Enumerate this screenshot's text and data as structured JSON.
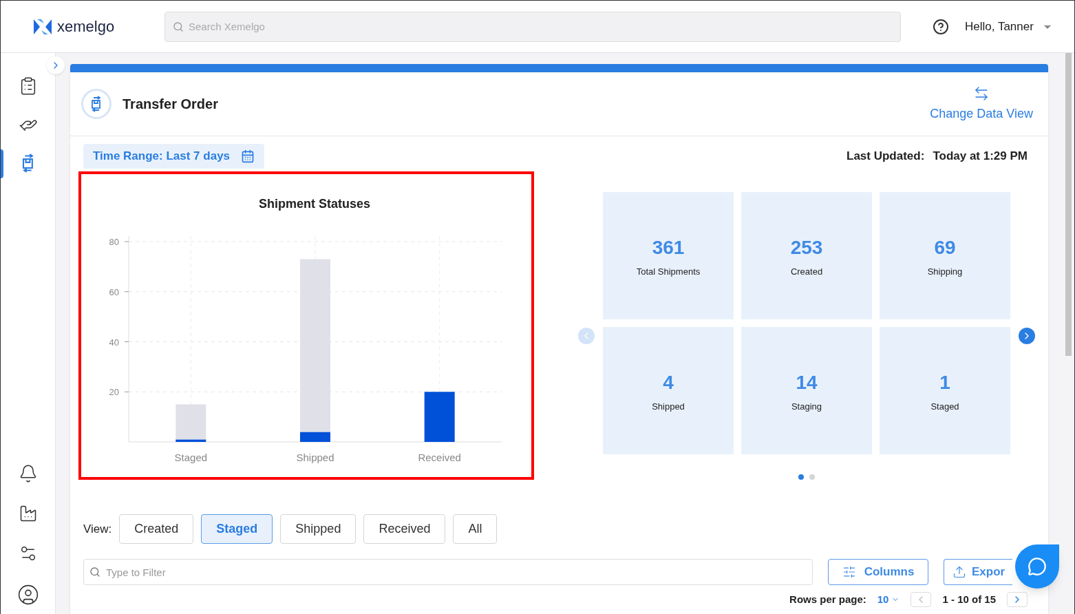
{
  "header": {
    "logo": "xemelgo",
    "search": {
      "placeholder": "Search Xemelgo"
    },
    "user": "Hello, Tanner"
  },
  "sidebar": {
    "items": [
      {
        "selected": false
      },
      {
        "selected": false
      },
      {
        "selected": true
      }
    ]
  },
  "page": {
    "title": "Transfer Order",
    "change_view": "Change Data View",
    "time_range": "Time Range: Last 7 days",
    "last_updated_label": "Last Updated:",
    "last_updated": "Today at 1:29 PM"
  },
  "chart": {
    "chart_data": {
      "type": "bar",
      "title": "Shipment Statuses",
      "categories": [
        "Staged",
        "Shipped",
        "Received"
      ],
      "stacked": true,
      "grid": true,
      "ylim": [
        0,
        80
      ],
      "yticks": [
        20,
        40,
        60,
        80
      ],
      "series": [
        {
          "color": "#0050d8",
          "values": [
            1,
            4,
            20
          ]
        },
        {
          "color": "#e0e0e8",
          "values": [
            14,
            69,
            null
          ]
        }
      ]
    }
  },
  "stats": [
    {
      "value": "361",
      "label": "Total Shipments"
    },
    {
      "value": "253",
      "label": "Created"
    },
    {
      "value": "69",
      "label": "Shipping"
    },
    {
      "value": "4",
      "label": "Shipped"
    },
    {
      "value": "14",
      "label": "Staging"
    },
    {
      "value": "1",
      "label": "Staged"
    }
  ],
  "carousel": {
    "prev_disabled": true,
    "pages": [
      {
        "selected": true
      },
      {
        "selected": false
      }
    ]
  },
  "view": {
    "label": "View:",
    "options": [
      {
        "label": "Created",
        "selected": false
      },
      {
        "label": "Staged",
        "selected": true
      },
      {
        "label": "Shipped",
        "selected": false
      },
      {
        "label": "Received",
        "selected": false
      },
      {
        "label": "All",
        "selected": false
      }
    ]
  },
  "filter": {
    "placeholder": "Type to Filter"
  },
  "buttons": {
    "columns": "Columns",
    "export": "Expor"
  },
  "pagination": {
    "rows_label": "Rows per page:",
    "rows_value": "10",
    "range": "1 - 10 of 15"
  }
}
